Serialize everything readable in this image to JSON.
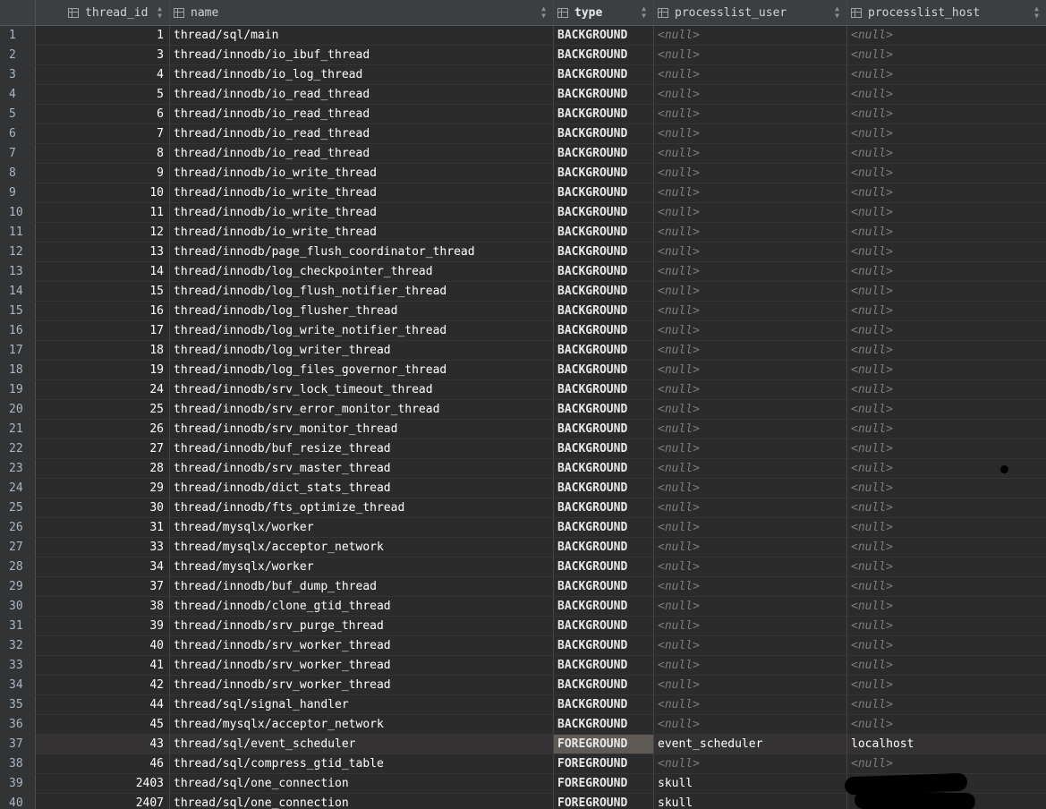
{
  "columns": [
    {
      "label": ""
    },
    {
      "label": "thread_id",
      "icon": "table-column-icon",
      "sort_icon": "sort-icon"
    },
    {
      "label": "name",
      "icon": "table-column-icon",
      "sort_icon": "sort-icon"
    },
    {
      "label": "type",
      "icon": "table-column-icon",
      "sort_icon": "sort-icon"
    },
    {
      "label": "processlist_user",
      "icon": "table-column-icon",
      "sort_icon": "sort-icon"
    },
    {
      "label": "processlist_host",
      "icon": "table-column-icon",
      "sort_icon": "sort-icon"
    }
  ],
  "null_label": "<null>",
  "rows": [
    {
      "n": "1",
      "thread_id": "1",
      "name": "thread/sql/main",
      "type": "BACKGROUND",
      "user": "<null>",
      "host": "<null>"
    },
    {
      "n": "2",
      "thread_id": "3",
      "name": "thread/innodb/io_ibuf_thread",
      "type": "BACKGROUND",
      "user": "<null>",
      "host": "<null>"
    },
    {
      "n": "3",
      "thread_id": "4",
      "name": "thread/innodb/io_log_thread",
      "type": "BACKGROUND",
      "user": "<null>",
      "host": "<null>"
    },
    {
      "n": "4",
      "thread_id": "5",
      "name": "thread/innodb/io_read_thread",
      "type": "BACKGROUND",
      "user": "<null>",
      "host": "<null>"
    },
    {
      "n": "5",
      "thread_id": "6",
      "name": "thread/innodb/io_read_thread",
      "type": "BACKGROUND",
      "user": "<null>",
      "host": "<null>"
    },
    {
      "n": "6",
      "thread_id": "7",
      "name": "thread/innodb/io_read_thread",
      "type": "BACKGROUND",
      "user": "<null>",
      "host": "<null>"
    },
    {
      "n": "7",
      "thread_id": "8",
      "name": "thread/innodb/io_read_thread",
      "type": "BACKGROUND",
      "user": "<null>",
      "host": "<null>"
    },
    {
      "n": "8",
      "thread_id": "9",
      "name": "thread/innodb/io_write_thread",
      "type": "BACKGROUND",
      "user": "<null>",
      "host": "<null>"
    },
    {
      "n": "9",
      "thread_id": "10",
      "name": "thread/innodb/io_write_thread",
      "type": "BACKGROUND",
      "user": "<null>",
      "host": "<null>"
    },
    {
      "n": "10",
      "thread_id": "11",
      "name": "thread/innodb/io_write_thread",
      "type": "BACKGROUND",
      "user": "<null>",
      "host": "<null>"
    },
    {
      "n": "11",
      "thread_id": "12",
      "name": "thread/innodb/io_write_thread",
      "type": "BACKGROUND",
      "user": "<null>",
      "host": "<null>"
    },
    {
      "n": "12",
      "thread_id": "13",
      "name": "thread/innodb/page_flush_coordinator_thread",
      "type": "BACKGROUND",
      "user": "<null>",
      "host": "<null>"
    },
    {
      "n": "13",
      "thread_id": "14",
      "name": "thread/innodb/log_checkpointer_thread",
      "type": "BACKGROUND",
      "user": "<null>",
      "host": "<null>"
    },
    {
      "n": "14",
      "thread_id": "15",
      "name": "thread/innodb/log_flush_notifier_thread",
      "type": "BACKGROUND",
      "user": "<null>",
      "host": "<null>"
    },
    {
      "n": "15",
      "thread_id": "16",
      "name": "thread/innodb/log_flusher_thread",
      "type": "BACKGROUND",
      "user": "<null>",
      "host": "<null>"
    },
    {
      "n": "16",
      "thread_id": "17",
      "name": "thread/innodb/log_write_notifier_thread",
      "type": "BACKGROUND",
      "user": "<null>",
      "host": "<null>"
    },
    {
      "n": "17",
      "thread_id": "18",
      "name": "thread/innodb/log_writer_thread",
      "type": "BACKGROUND",
      "user": "<null>",
      "host": "<null>"
    },
    {
      "n": "18",
      "thread_id": "19",
      "name": "thread/innodb/log_files_governor_thread",
      "type": "BACKGROUND",
      "user": "<null>",
      "host": "<null>"
    },
    {
      "n": "19",
      "thread_id": "24",
      "name": "thread/innodb/srv_lock_timeout_thread",
      "type": "BACKGROUND",
      "user": "<null>",
      "host": "<null>"
    },
    {
      "n": "20",
      "thread_id": "25",
      "name": "thread/innodb/srv_error_monitor_thread",
      "type": "BACKGROUND",
      "user": "<null>",
      "host": "<null>"
    },
    {
      "n": "21",
      "thread_id": "26",
      "name": "thread/innodb/srv_monitor_thread",
      "type": "BACKGROUND",
      "user": "<null>",
      "host": "<null>"
    },
    {
      "n": "22",
      "thread_id": "27",
      "name": "thread/innodb/buf_resize_thread",
      "type": "BACKGROUND",
      "user": "<null>",
      "host": "<null>"
    },
    {
      "n": "23",
      "thread_id": "28",
      "name": "thread/innodb/srv_master_thread",
      "type": "BACKGROUND",
      "user": "<null>",
      "host": "<null>"
    },
    {
      "n": "24",
      "thread_id": "29",
      "name": "thread/innodb/dict_stats_thread",
      "type": "BACKGROUND",
      "user": "<null>",
      "host": "<null>"
    },
    {
      "n": "25",
      "thread_id": "30",
      "name": "thread/innodb/fts_optimize_thread",
      "type": "BACKGROUND",
      "user": "<null>",
      "host": "<null>"
    },
    {
      "n": "26",
      "thread_id": "31",
      "name": "thread/mysqlx/worker",
      "type": "BACKGROUND",
      "user": "<null>",
      "host": "<null>"
    },
    {
      "n": "27",
      "thread_id": "33",
      "name": "thread/mysqlx/acceptor_network",
      "type": "BACKGROUND",
      "user": "<null>",
      "host": "<null>"
    },
    {
      "n": "28",
      "thread_id": "34",
      "name": "thread/mysqlx/worker",
      "type": "BACKGROUND",
      "user": "<null>",
      "host": "<null>"
    },
    {
      "n": "29",
      "thread_id": "37",
      "name": "thread/innodb/buf_dump_thread",
      "type": "BACKGROUND",
      "user": "<null>",
      "host": "<null>"
    },
    {
      "n": "30",
      "thread_id": "38",
      "name": "thread/innodb/clone_gtid_thread",
      "type": "BACKGROUND",
      "user": "<null>",
      "host": "<null>"
    },
    {
      "n": "31",
      "thread_id": "39",
      "name": "thread/innodb/srv_purge_thread",
      "type": "BACKGROUND",
      "user": "<null>",
      "host": "<null>"
    },
    {
      "n": "32",
      "thread_id": "40",
      "name": "thread/innodb/srv_worker_thread",
      "type": "BACKGROUND",
      "user": "<null>",
      "host": "<null>"
    },
    {
      "n": "33",
      "thread_id": "41",
      "name": "thread/innodb/srv_worker_thread",
      "type": "BACKGROUND",
      "user": "<null>",
      "host": "<null>"
    },
    {
      "n": "34",
      "thread_id": "42",
      "name": "thread/innodb/srv_worker_thread",
      "type": "BACKGROUND",
      "user": "<null>",
      "host": "<null>"
    },
    {
      "n": "35",
      "thread_id": "44",
      "name": "thread/sql/signal_handler",
      "type": "BACKGROUND",
      "user": "<null>",
      "host": "<null>"
    },
    {
      "n": "36",
      "thread_id": "45",
      "name": "thread/mysqlx/acceptor_network",
      "type": "BACKGROUND",
      "user": "<null>",
      "host": "<null>"
    },
    {
      "n": "37",
      "thread_id": "43",
      "name": "thread/sql/event_scheduler",
      "type": "FOREGROUND",
      "user": "event_scheduler",
      "host": "localhost"
    },
    {
      "n": "38",
      "thread_id": "46",
      "name": "thread/sql/compress_gtid_table",
      "type": "FOREGROUND",
      "user": "<null>",
      "host": "<null>"
    },
    {
      "n": "39",
      "thread_id": "2403",
      "name": "thread/sql/one_connection",
      "type": "FOREGROUND",
      "user": "skull",
      "host": ""
    },
    {
      "n": "40",
      "thread_id": "2407",
      "name": "thread/sql/one_connection",
      "type": "FOREGROUND",
      "user": "skull",
      "host": ""
    }
  ],
  "colors": {
    "background": "#2b2b2b",
    "header": "#3c3f41",
    "selected_type_cell": "#5f5a55",
    "null_text": "#7c7c7c"
  }
}
